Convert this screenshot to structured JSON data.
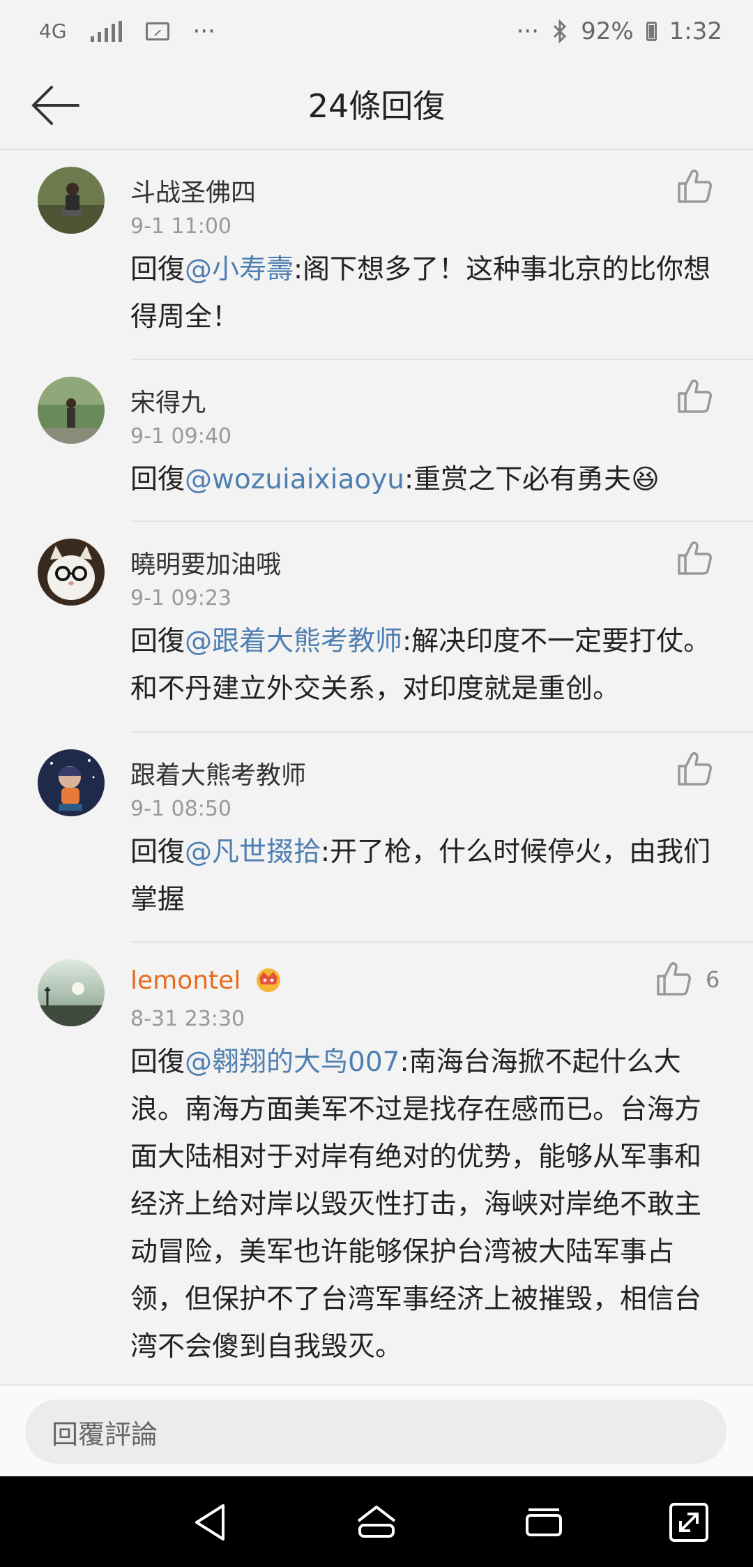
{
  "status_bar": {
    "network": "4G",
    "left_more": "···",
    "right_more": "···",
    "battery": "92%",
    "time": "1:32"
  },
  "header": {
    "title": "24條回復"
  },
  "comments": [
    {
      "name": "斗战圣佛四",
      "time": "9-1 11:00",
      "reply_prefix": "回復",
      "mention": "@小寿壽",
      "text": ":阁下想多了！这种事北京的比你想得周全！"
    },
    {
      "name": "宋得九",
      "time": "9-1 09:40",
      "reply_prefix": "回復",
      "mention": "@wozuiaixiaoyu",
      "text": ":重赏之下必有勇夫😆"
    },
    {
      "name": "曉明要加油哦",
      "time": "9-1 09:23",
      "reply_prefix": "回復",
      "mention": "@跟着大熊考教师",
      "text": ":解决印度不一定要打仗。和不丹建立外交关系，对印度就是重创。"
    },
    {
      "name": "跟着大熊考教师",
      "time": "9-1 08:50",
      "reply_prefix": "回復",
      "mention": "@凡世掇拾",
      "text": ":开了枪，什么时候停火，由我们掌握"
    },
    {
      "name": "lemontel",
      "time": "8-31 23:30",
      "likes": "6",
      "reply_prefix": "回復",
      "mention": "@翱翔的大鸟007",
      "text": ":南海台海掀不起什么大浪。南海方面美军不过是找存在感而已。台海方面大陆相对于对岸有绝对的优势，能够从军事和经济上给对岸以毁灭性打击，海峡对岸绝不敢主动冒险，美军也许能够保护台湾被大陆军事占领，但保护不了台湾军事经济上被摧毁，相信台湾不会傻到自我毁灭。"
    }
  ],
  "reply_bar": {
    "placeholder": "回覆評論"
  },
  "icons": {
    "back": "arrow-left-icon",
    "like": "thumbs-up-icon",
    "crown": "crown-badge-icon",
    "nav_back": "triangle-back-icon",
    "nav_home": "home-icon",
    "nav_recents": "recents-icon",
    "nav_expand": "expand-icon"
  },
  "colors": {
    "mention": "#4f7fb0",
    "vip_name": "#e86a1a",
    "background": "#f3f3f3"
  }
}
